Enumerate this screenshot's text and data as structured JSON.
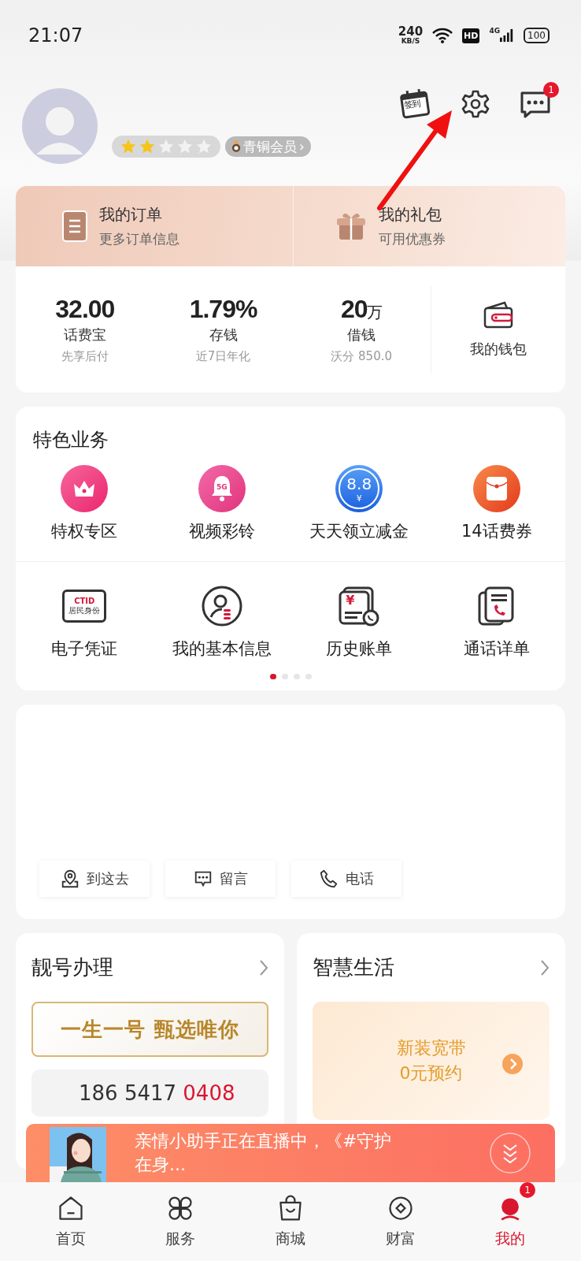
{
  "status_bar": {
    "time": "21:07",
    "speed": "240",
    "speed_unit": "KB/S",
    "hd": "HD",
    "network": "4G",
    "battery": "100"
  },
  "profile": {
    "stars": 2,
    "member_level": "青铜会员",
    "member_chevron": "›",
    "checkin_label": "签到",
    "message_badge": "1"
  },
  "quick_links": [
    {
      "kind": "order",
      "title": "我的订单",
      "subtitle": "更多订单信息"
    },
    {
      "kind": "gift",
      "title": "我的礼包",
      "subtitle": "可用优惠券"
    }
  ],
  "wallet_stats": [
    {
      "value": "32.00",
      "label": "话费宝",
      "note": "先享后付"
    },
    {
      "value": "1.79%",
      "label": "存钱",
      "note": "近7日年化"
    },
    {
      "value": "20",
      "unit": "万",
      "label": "借钱",
      "note": "沃分 850.0"
    }
  ],
  "wallet": {
    "label": "我的钱包"
  },
  "featured": {
    "title": "特色业务",
    "rows": [
      [
        {
          "kind": "crown",
          "label": "特权专区"
        },
        {
          "kind": "bell",
          "icon_text": "5G",
          "label": "视频彩铃"
        },
        {
          "kind": "coin",
          "icon_text": "8.8",
          "icon_sub": "¥",
          "label": "天天领立减金"
        },
        {
          "kind": "envelope",
          "label": "14话费券"
        }
      ],
      [
        {
          "kind": "id-card",
          "icon_text": "CTID",
          "icon_sub": "居民身份",
          "label": "电子凭证"
        },
        {
          "kind": "user",
          "label": "我的基本信息"
        },
        {
          "kind": "bill",
          "icon_text": "¥",
          "label": "历史账单"
        },
        {
          "kind": "call-log",
          "label": "通话详单"
        }
      ]
    ]
  },
  "page_dots": [
    {
      "selected": true
    },
    {
      "selected": false
    },
    {
      "selected": false
    },
    {
      "selected": false
    }
  ],
  "location_actions": [
    {
      "kind": "map-pin",
      "label": "到这去"
    },
    {
      "kind": "chat",
      "label": "留言"
    },
    {
      "kind": "phone",
      "label": "电话"
    }
  ],
  "number_card": {
    "title": "靓号办理",
    "slogan": "一生一号 甄选唯你",
    "number_prefix": "186 5417 ",
    "number_suffix": "0408"
  },
  "life_card": {
    "title": "智慧生活",
    "promo_lines": [
      "新装宽带",
      "0元预约"
    ]
  },
  "live_banner": {
    "text": "亲情小助手正在直播中，《#守护在身..."
  },
  "tab_bar": [
    {
      "kind": "home",
      "label": "首页",
      "selected": false
    },
    {
      "kind": "grid",
      "label": "服务",
      "selected": false
    },
    {
      "kind": "bag",
      "label": "商城",
      "selected": false
    },
    {
      "kind": "coin",
      "label": "财富",
      "selected": false
    },
    {
      "kind": "me",
      "label": "我的",
      "selected": true,
      "badge": "1"
    }
  ]
}
